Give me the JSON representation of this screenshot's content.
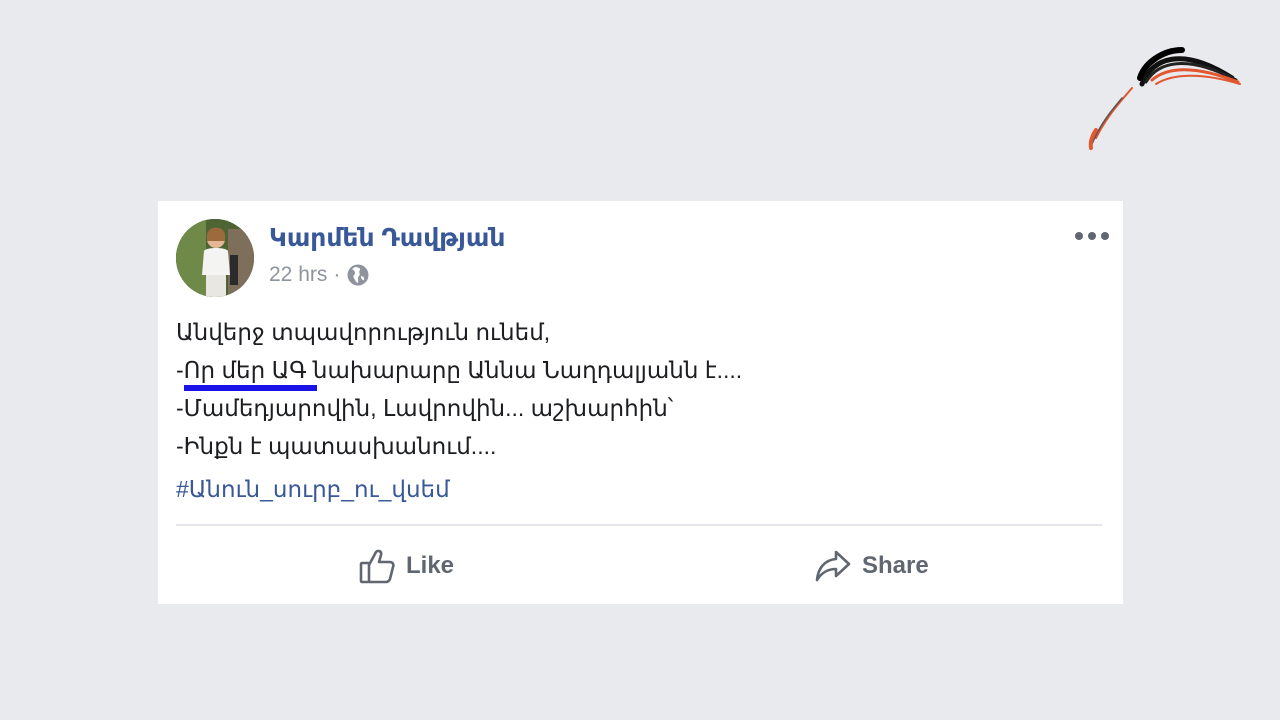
{
  "post": {
    "author_name": "Կարմեն Դավթյան",
    "timestamp": "22 hrs",
    "separator": "·",
    "privacy_icon": "globe-icon",
    "more_icon": "more-options-icon",
    "body_lines": [
      "Անվերջ տպավորություն ունեմ,",
      "-Որ մեր ԱԳ նախարարը Աննա Նաղդալյանն է....",
      "-Մամեդյարովին, Լավրովին... աշխարհին՝",
      "-Ինքն է պատասխանում...."
    ],
    "hashtag": "#Անուն_սուրբ_ու_վսեմ"
  },
  "actions": {
    "like_label": "Like",
    "like_icon": "thumbs-up-icon",
    "share_label": "Share",
    "share_icon": "share-arrow-icon"
  },
  "colors": {
    "background": "#e9eaee",
    "card": "#ffffff",
    "link_blue": "#385898",
    "underline_mark": "#1a12e6",
    "logo_red": "#e2572f"
  }
}
